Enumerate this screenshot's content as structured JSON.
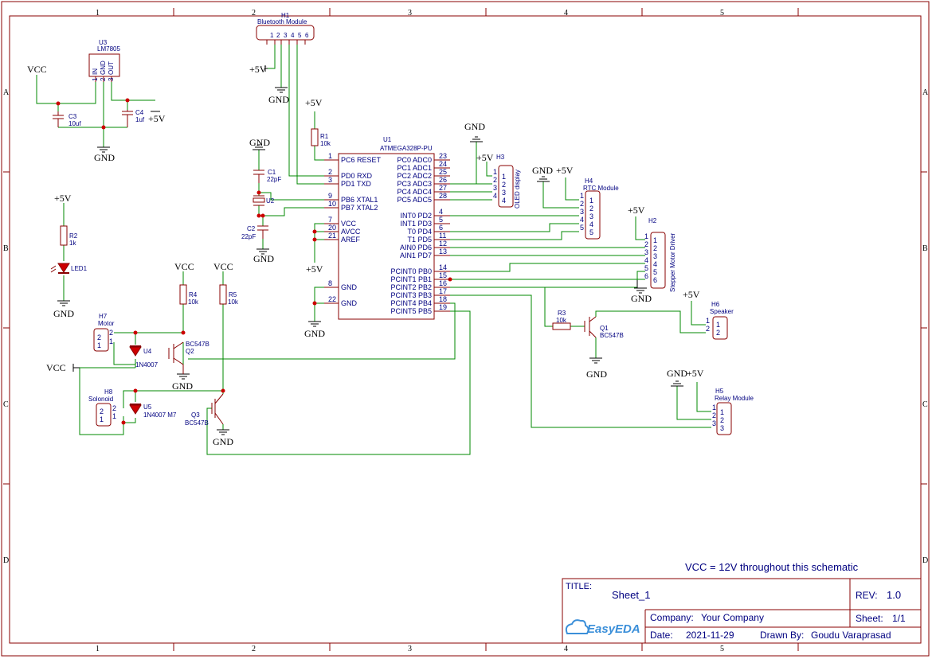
{
  "border": {
    "columns": [
      "1",
      "2",
      "3",
      "4",
      "5"
    ],
    "rows": [
      "A",
      "B",
      "C",
      "D"
    ]
  },
  "note": "VCC = 12V throughout this schematic",
  "title_block": {
    "title_label": "TITLE:",
    "title_value": "Sheet_1",
    "rev_label": "REV:",
    "rev_value": "1.0",
    "company_label": "Company:",
    "company_value": "Your Company",
    "sheet_label": "Sheet:",
    "sheet_value": "1/1",
    "date_label": "Date:",
    "date_value": "2021-11-29",
    "drawn_label": "Drawn By:",
    "drawn_value": "Goudu Varaprasad",
    "logo_text": "EasyEDA"
  },
  "power": {
    "vcc": "VCC",
    "p5v": "+5V",
    "gnd": "GND"
  },
  "components": {
    "u3": {
      "ref": "U3",
      "value": "LM7805",
      "pins": [
        "IN",
        "GND",
        "OUT"
      ],
      "nums": [
        "1",
        "2",
        "3"
      ]
    },
    "c3": {
      "ref": "C3",
      "value": "10uf"
    },
    "c4": {
      "ref": "C4",
      "value": "1uf"
    },
    "h1": {
      "ref": "H1",
      "value": "Bluetooth Module",
      "pins": [
        "1",
        "2",
        "3",
        "4",
        "5",
        "6"
      ]
    },
    "r1": {
      "ref": "R1",
      "value": "10k"
    },
    "c1": {
      "ref": "C1",
      "value": "22pF"
    },
    "c2": {
      "ref": "C2",
      "value": "22pF"
    },
    "u2": {
      "ref": "U2"
    },
    "u1": {
      "ref": "U1",
      "value": "ATMEGA328P-PU",
      "left_pins": [
        {
          "num": "1",
          "name": "PC6 RESET"
        },
        {
          "num": "2",
          "name": "PD0 RXD"
        },
        {
          "num": "3",
          "name": "PD1 TXD"
        },
        {
          "num": "9",
          "name": "PB6 XTAL1"
        },
        {
          "num": "10",
          "name": "PB7 XTAL2"
        },
        {
          "num": "7",
          "name": "VCC"
        },
        {
          "num": "20",
          "name": "AVCC"
        },
        {
          "num": "21",
          "name": "AREF"
        },
        {
          "num": "8",
          "name": "GND"
        },
        {
          "num": "22",
          "name": "GND"
        }
      ],
      "right_pins": [
        {
          "num": "23",
          "name": "PC0 ADC0"
        },
        {
          "num": "24",
          "name": "PC1 ADC1"
        },
        {
          "num": "25",
          "name": "PC2 ADC2"
        },
        {
          "num": "26",
          "name": "PC3 ADC3"
        },
        {
          "num": "27",
          "name": "PC4 ADC4"
        },
        {
          "num": "28",
          "name": "PC5 ADC5"
        },
        {
          "num": "4",
          "name": "INT0 PD2"
        },
        {
          "num": "5",
          "name": "INT1 PD3"
        },
        {
          "num": "6",
          "name": "T0 PD4"
        },
        {
          "num": "11",
          "name": "T1 PD5"
        },
        {
          "num": "12",
          "name": "AIN0 PD6"
        },
        {
          "num": "13",
          "name": "AIN1 PD7"
        },
        {
          "num": "14",
          "name": "PCINT0 PB0"
        },
        {
          "num": "15",
          "name": "PCINT1 PB1"
        },
        {
          "num": "16",
          "name": "PCINT2 PB2"
        },
        {
          "num": "17",
          "name": "PCINT3 PB3"
        },
        {
          "num": "18",
          "name": "PCINT4 PB4"
        },
        {
          "num": "19",
          "name": "PCINT5 PB5"
        }
      ]
    },
    "h3": {
      "ref": "H3",
      "value": "OLED display",
      "pins": [
        "1",
        "2",
        "3",
        "4"
      ]
    },
    "h4": {
      "ref": "H4",
      "value": "RTC Module",
      "pins": [
        "1",
        "2",
        "3",
        "4",
        "5"
      ]
    },
    "h2": {
      "ref": "H2",
      "value": "Stepper Motor Driver",
      "pins": [
        "1",
        "2",
        "3",
        "4",
        "5",
        "6"
      ]
    },
    "r2": {
      "ref": "R2",
      "value": "1k"
    },
    "led1": {
      "ref": "LED1"
    },
    "r4": {
      "ref": "R4",
      "value": "10k"
    },
    "r5": {
      "ref": "R5",
      "value": "10k"
    },
    "h7": {
      "ref": "H7",
      "value": "Motor",
      "pins": [
        "2",
        "1"
      ]
    },
    "u4": {
      "ref": "U4",
      "value": "1N4007"
    },
    "q2": {
      "ref": "Q2",
      "value": "BC547B"
    },
    "h8": {
      "ref": "H8",
      "value": "Solonoid",
      "pins": [
        "2",
        "1"
      ]
    },
    "u5": {
      "ref": "U5",
      "value": "1N4007 M7"
    },
    "q3": {
      "ref": "Q3",
      "value": "BC547B"
    },
    "r3": {
      "ref": "R3",
      "value": "10k"
    },
    "q1": {
      "ref": "Q1",
      "value": "BC547B"
    },
    "h6": {
      "ref": "H6",
      "value": "Speaker",
      "pins": [
        "1",
        "2"
      ]
    },
    "h5": {
      "ref": "H5",
      "value": "Relay Module",
      "pins": [
        "1",
        "2",
        "3"
      ]
    }
  }
}
